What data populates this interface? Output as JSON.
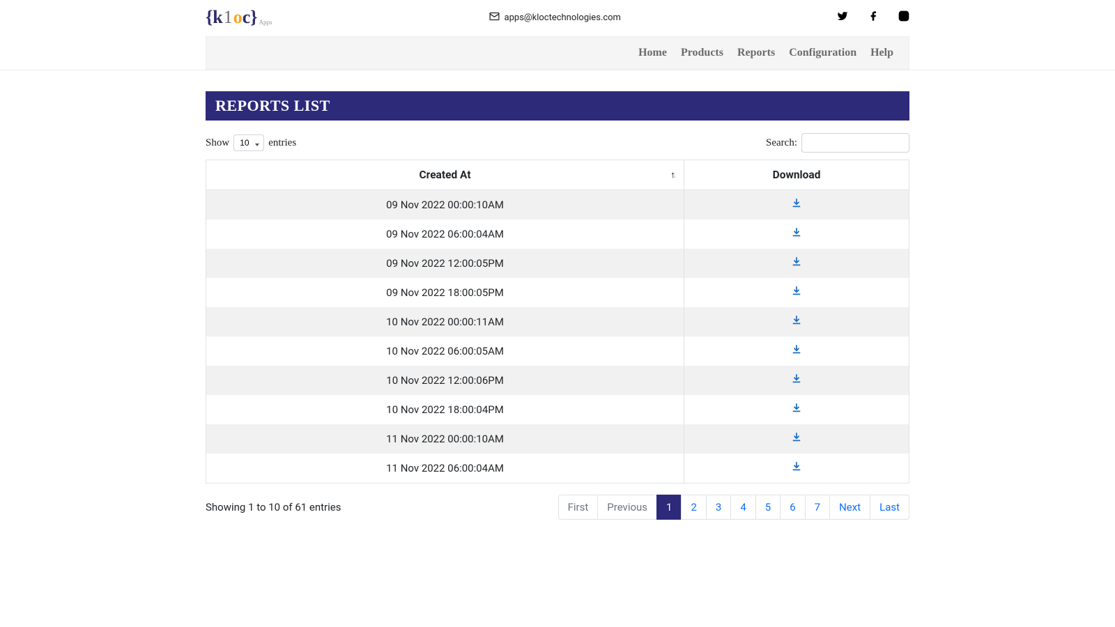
{
  "header": {
    "logo_apps_suffix": "Apps",
    "email": "apps@kloctechnologies.com"
  },
  "nav": {
    "items": [
      {
        "label": "Home"
      },
      {
        "label": "Products"
      },
      {
        "label": "Reports"
      },
      {
        "label": "Configuration"
      },
      {
        "label": "Help"
      }
    ]
  },
  "page": {
    "title": "REPORTS LIST"
  },
  "table_controls": {
    "show_prefix": "Show",
    "show_suffix": "entries",
    "entries_value": "10",
    "search_label": "Search:"
  },
  "table": {
    "headers": {
      "created_at": "Created At",
      "download": "Download"
    },
    "rows": [
      {
        "created_at": "09 Nov 2022 00:00:10AM"
      },
      {
        "created_at": "09 Nov 2022 06:00:04AM"
      },
      {
        "created_at": "09 Nov 2022 12:00:05PM"
      },
      {
        "created_at": "09 Nov 2022 18:00:05PM"
      },
      {
        "created_at": "10 Nov 2022 00:00:11AM"
      },
      {
        "created_at": "10 Nov 2022 06:00:05AM"
      },
      {
        "created_at": "10 Nov 2022 12:00:06PM"
      },
      {
        "created_at": "10 Nov 2022 18:00:04PM"
      },
      {
        "created_at": "11 Nov 2022 00:00:10AM"
      },
      {
        "created_at": "11 Nov 2022 06:00:04AM"
      }
    ]
  },
  "footer": {
    "info": "Showing 1 to 10 of 61 entries",
    "pagination": {
      "first": "First",
      "previous": "Previous",
      "pages": [
        "1",
        "2",
        "3",
        "4",
        "5",
        "6",
        "7"
      ],
      "active_index": 0,
      "next": "Next",
      "last": "Last"
    }
  }
}
